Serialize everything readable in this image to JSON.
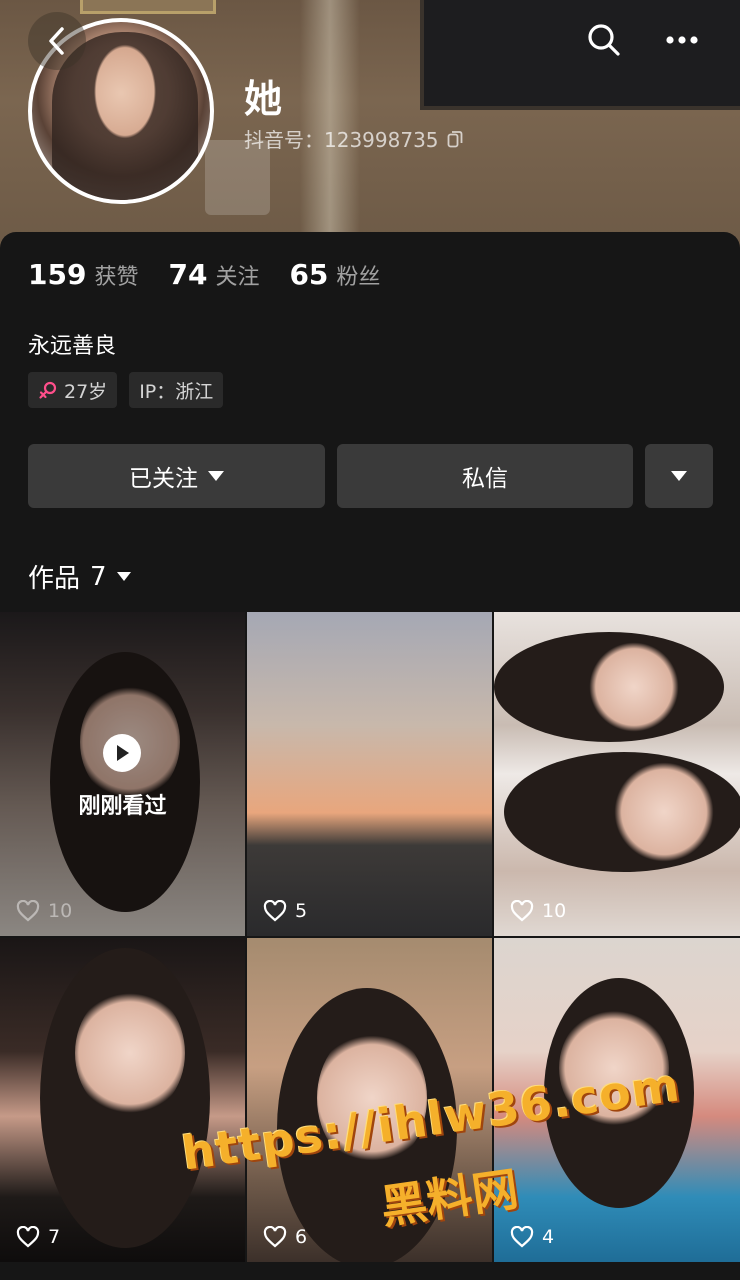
{
  "profile": {
    "name": "她",
    "id_label": "抖音号：123998735",
    "bio": "永远善良"
  },
  "stats": [
    {
      "value": "159",
      "label": "获赞"
    },
    {
      "value": "74",
      "label": "关注"
    },
    {
      "value": "65",
      "label": "粉丝"
    }
  ],
  "tags": {
    "age": "27岁",
    "ip": "IP：浙江",
    "gender_color": "#ff4f8b"
  },
  "actions": {
    "follow_label": "已关注",
    "message_label": "私信"
  },
  "works": {
    "label": "作品",
    "count": "7"
  },
  "videos": [
    {
      "likes": "10",
      "watched_label": "刚刚看过"
    },
    {
      "likes": "5"
    },
    {
      "likes": "10"
    },
    {
      "likes": "7"
    },
    {
      "likes": "6"
    },
    {
      "likes": "4"
    }
  ],
  "watermark": {
    "line1": "https://ihlw36.com",
    "line2": "黑料网"
  },
  "icons": [
    "back-icon",
    "search-icon",
    "more-icon",
    "copy-icon",
    "female-icon",
    "heart-icon",
    "play-icon",
    "triangle-down-icon"
  ]
}
